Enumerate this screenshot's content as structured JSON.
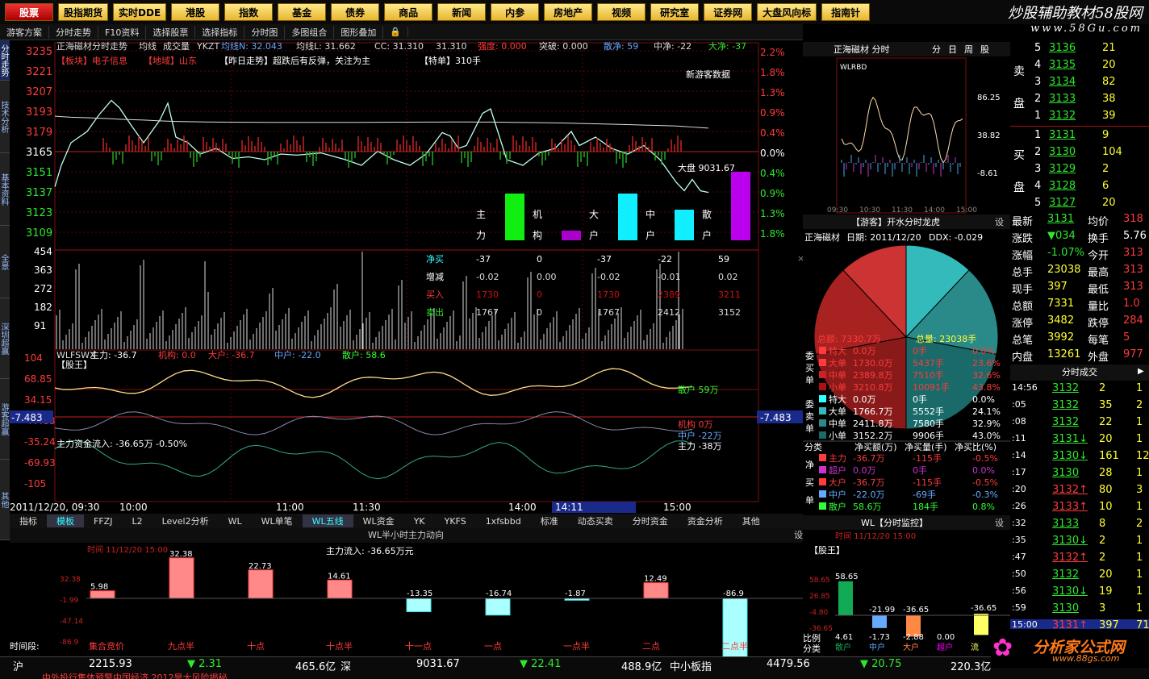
{
  "nav": [
    "股票",
    "股指期货",
    "实时DDE",
    "港股",
    "指数",
    "基金",
    "债券",
    "商品",
    "新闻",
    "内参",
    "房地产",
    "视频",
    "研究室",
    "证券网",
    "大盘风向标",
    "指南针"
  ],
  "brand": {
    "title": "炒股辅助教材58股网",
    "url": "www.58Gu.com"
  },
  "toolbar": [
    "游客方案",
    "分时走势",
    "F10资料",
    "选择股票",
    "选择指标",
    "分时图",
    "多图组合",
    "图形叠加"
  ],
  "chart_header": {
    "title": "正海磁材分时走势",
    "ind": "均线",
    "vol": "成交量",
    "yk": "YKZT",
    "jx_label": "均线N:",
    "jx": "32.043",
    "jxl_label": "均线L:",
    "jxl": "31.662",
    "cc": "CC: 31.310",
    "cc2": "31.310",
    "ysh": "强度:",
    "ysh_v": "0.000",
    "tp": "突破: 0.000",
    "sj": "散净: 59",
    "zj": "中净: -22",
    "dj": "大净: -37"
  },
  "tags": {
    "block": "【板块】电子信息",
    "area": "【地域】山东",
    "trend": "【昨日走势】超跌后有反弹，关注为主",
    "tedan": "【特单】310手",
    "guest": "新游客数据"
  },
  "price_axis": [
    "3235",
    "3221",
    "3207",
    "3193",
    "3179",
    "3165",
    "3151",
    "3137",
    "3123",
    "3109"
  ],
  "pct_axis_up": [
    "2.2%",
    "1.8%",
    "1.3%",
    "0.9%",
    "0.4%",
    "0.0%"
  ],
  "pct_axis_dn": [
    "0.4%",
    "0.9%",
    "1.3%",
    "1.8%"
  ],
  "dapan": "大盘 9031.67",
  "bars_labels": [
    {
      "t": "主",
      "b": "力"
    },
    {
      "t": "机",
      "b": "构"
    },
    {
      "t": "大",
      "b": "户"
    },
    {
      "t": "中",
      "b": "户"
    },
    {
      "t": "散",
      "b": "户"
    }
  ],
  "vol_axis": [
    "454",
    "363",
    "272",
    "182",
    "91"
  ],
  "flow_table": {
    "rows": [
      {
        "k": "净买",
        "v": [
          "-37",
          "0",
          "-37",
          "-22",
          "59"
        ]
      },
      {
        "k": "增减",
        "v": [
          "-0.02",
          "0.00",
          "-0.02",
          "-0.01",
          "0.02"
        ]
      },
      {
        "k": "买入",
        "v": [
          "1730",
          "0",
          "1730",
          "2389",
          "3211"
        ]
      },
      {
        "k": "卖出",
        "v": [
          "1767",
          "0",
          "1767",
          "2412",
          "3152"
        ]
      }
    ]
  },
  "wl_header": {
    "name": "WLFSWX",
    "zl": "主力: -36.7",
    "jg": "机构: 0.0",
    "dh": "大户: -36.7",
    "zh": "中户: -22.0",
    "sh": "散户: 58.6"
  },
  "gw": "【股王】",
  "wl_axis": [
    "104",
    "68.85",
    "34.15",
    "-7.483",
    "-35.24",
    "-69.93",
    "-105"
  ],
  "wl_labels": {
    "sh": "散户 59万",
    "jg": "机构 0万",
    "zh": "中户 -22万",
    "zl": "主力 -38万",
    "flow": "主力资金流入: -36.65万  -0.50%",
    "cur": "-7.483"
  },
  "time_axis": {
    "date": "2011/12/20, 09:30",
    "t1": "10:00",
    "t2": "11:00",
    "t3": "11:30",
    "t4": "14:00",
    "t5": "14:11",
    "t6": "15:00"
  },
  "mid_tabs": [
    "指标",
    "模板",
    "FFZJ",
    "L2",
    "Level2分析",
    "WL",
    "WL单笔",
    "WL五线",
    "WL资金",
    "YK",
    "YKFS",
    "1xfsbbd",
    "标准",
    "动态买卖",
    "分时资金",
    "资金分析",
    "其他"
  ],
  "halfhour": {
    "title": "WL半小时主力动向",
    "time": "时间  11/12/20 15:00",
    "flow": "主力流入: -36.65万元",
    "axis": [
      "32.38",
      "-1.99",
      "-47.14",
      "-86.9"
    ],
    "tl": "时间段:",
    "bars": [
      {
        "v": 5.98,
        "lab": "集合竞价",
        "vl": "5.98"
      },
      {
        "v": 32.38,
        "lab": "九点半",
        "vl": "32.38"
      },
      {
        "v": 22.73,
        "lab": "十点",
        "vl": "22.73"
      },
      {
        "v": 14.61,
        "lab": "十点半",
        "vl": "14.61"
      },
      {
        "v": -13.35,
        "lab": "十一点",
        "vl": "-13.35"
      },
      {
        "v": -16.74,
        "lab": "一点",
        "vl": "-16.74"
      },
      {
        "v": -1.87,
        "lab": "一点半",
        "vl": "-1.87"
      },
      {
        "v": 12.49,
        "lab": "二点",
        "vl": "12.49"
      },
      {
        "v": -86.9,
        "lab": "二点半",
        "vl": "-86.9"
      }
    ]
  },
  "mini": {
    "title": "正海磁材 分时",
    "tabs": [
      "分",
      "日",
      "周",
      "股"
    ],
    "name": "WLRBD",
    "axis": [
      "86.25",
      "38.82",
      "-8.61"
    ],
    "times": [
      "09:30",
      "10:30",
      "11:30",
      "14:00",
      "15:00"
    ]
  },
  "pie": {
    "title": "【游客】开水分时龙虎",
    "name": "正海磁材",
    "date": "日期: 2011/12/20",
    "ddx": "DDX: -0.029",
    "total_amt": "总额: 7330.7万",
    "total_vol": "总量: 23038手",
    "buy": [
      {
        "k": "特大",
        "a": "0.0万",
        "v": "0手",
        "p": "0.0%"
      },
      {
        "k": "大单",
        "a": "1730.0万",
        "v": "5437手",
        "p": "23.6%"
      },
      {
        "k": "中单",
        "a": "2389.8万",
        "v": "7510手",
        "p": "32.6%"
      },
      {
        "k": "小单",
        "a": "3210.8万",
        "v": "10091手",
        "p": "43.8%"
      }
    ],
    "sell": [
      {
        "k": "特大",
        "a": "0.0万",
        "v": "0手",
        "p": "0.0%"
      },
      {
        "k": "大单",
        "a": "1766.7万",
        "v": "5552手",
        "p": "24.1%"
      },
      {
        "k": "中单",
        "a": "2411.8万",
        "v": "7580手",
        "p": "32.9%"
      },
      {
        "k": "小单",
        "a": "3152.2万",
        "v": "9906手",
        "p": "43.0%"
      }
    ],
    "buy_side": "委买单",
    "sell_side": "委卖单"
  },
  "net": {
    "hdr": [
      "分类",
      "净买额(万)",
      "净买量(手)",
      "净买比(%)"
    ],
    "side": "净买单",
    "rows": [
      {
        "k": "主力",
        "a": "-36.7万",
        "v": "-115手",
        "p": "-0.5%"
      },
      {
        "k": "超户",
        "a": "0.0万",
        "v": "0手",
        "p": "0.0%"
      },
      {
        "k": "大户",
        "a": "-36.7万",
        "v": "-115手",
        "p": "-0.5%"
      },
      {
        "k": "中户",
        "a": "-22.0万",
        "v": "-69手",
        "p": "-0.3%"
      },
      {
        "k": "散户",
        "a": "58.6万",
        "v": "184手",
        "p": "0.8%"
      }
    ]
  },
  "monitor": {
    "title": "WL【分时监控】",
    "time": "时间  11/12/20 15:00",
    "gw": "【股王】",
    "axis": [
      "58.65",
      "26.85",
      "-4.80",
      "-36.65"
    ],
    "bars": [
      {
        "v": 58.65,
        "vl": "58.65",
        "lab": "散户",
        "b": "4.61"
      },
      {
        "v": -21.99,
        "vl": "-21.99",
        "lab": "中户",
        "b": "-1.73"
      },
      {
        "v": -36.65,
        "vl": "-36.65",
        "lab": "大户",
        "b": "-2.88"
      },
      {
        "v": 0,
        "vl": "",
        "lab": "超户",
        "b": "0.00"
      },
      {
        "v": -36.65,
        "vl": "-36.65",
        "lab": "流",
        "b": ""
      }
    ],
    "side1": "比例",
    "side2": "分类"
  },
  "orderbook": {
    "sell": [
      {
        "n": "5",
        "p": "3136",
        "v": "21"
      },
      {
        "n": "4",
        "p": "3135",
        "v": "20"
      },
      {
        "n": "3",
        "p": "3134",
        "v": "82"
      },
      {
        "n": "2",
        "p": "3133",
        "v": "38"
      },
      {
        "n": "1",
        "p": "3132",
        "v": "39"
      }
    ],
    "buy": [
      {
        "n": "1",
        "p": "3131",
        "v": "9"
      },
      {
        "n": "2",
        "p": "3130",
        "v": "104"
      },
      {
        "n": "3",
        "p": "3129",
        "v": "2"
      },
      {
        "n": "4",
        "p": "3128",
        "v": "6"
      },
      {
        "n": "5",
        "p": "3127",
        "v": "20"
      }
    ],
    "sl1": "卖",
    "sl2": "盘",
    "bl1": "买",
    "bl2": "盘"
  },
  "quote": [
    {
      "k": "最新",
      "v": "3131",
      "k2": "均价",
      "v2": "318"
    },
    {
      "k": "涨跌",
      "v": "▼034",
      "k2": "换手",
      "v2": "5.76"
    },
    {
      "k": "涨幅",
      "v": "-1.07%",
      "k2": "今开",
      "v2": "313"
    },
    {
      "k": "总手",
      "v": "23038",
      "k2": "最高",
      "v2": "313"
    },
    {
      "k": "现手",
      "v": "397",
      "k2": "最低",
      "v2": "313"
    },
    {
      "k": "总额",
      "v": "7331",
      "k2": "量比",
      "v2": "1.0"
    },
    {
      "k": "涨停",
      "v": "3482",
      "k2": "跌停",
      "v2": "284"
    },
    {
      "k": "总笔",
      "v": "3992",
      "k2": "每笔",
      "v2": "5"
    },
    {
      "k": "内盘",
      "v": "13261",
      "k2": "外盘",
      "v2": "977"
    }
  ],
  "ticks_title": "分时成交",
  "ticks": [
    {
      "t": "14:56",
      "p": "3132",
      "v": "2",
      "s": "1"
    },
    {
      "t": ":05",
      "p": "3132",
      "v": "35",
      "s": "2"
    },
    {
      "t": ":08",
      "p": "3132",
      "v": "22",
      "s": "1"
    },
    {
      "t": ":11",
      "p": "3131↓",
      "v": "20",
      "s": "1"
    },
    {
      "t": ":14",
      "p": "3130↓",
      "v": "161",
      "s": "12"
    },
    {
      "t": ":17",
      "p": "3130",
      "v": "28",
      "s": "1"
    },
    {
      "t": ":20",
      "p": "3132↑",
      "v": "80",
      "s": "3"
    },
    {
      "t": ":26",
      "p": "3133↑",
      "v": "10",
      "s": "1"
    },
    {
      "t": ":32",
      "p": "3133",
      "v": "8",
      "s": "2"
    },
    {
      "t": ":35",
      "p": "3130↓",
      "v": "2",
      "s": "1"
    },
    {
      "t": ":47",
      "p": "3132↑",
      "v": "2",
      "s": "1"
    },
    {
      "t": ":50",
      "p": "3132",
      "v": "20",
      "s": "1"
    },
    {
      "t": ":56",
      "p": "3130↓",
      "v": "19",
      "s": "1"
    },
    {
      "t": ":59",
      "p": "3130",
      "v": "3",
      "s": "1"
    },
    {
      "t": "15:00",
      "p": "3131↑",
      "v": "397",
      "s": "71"
    }
  ],
  "bottom": {
    "sh": "沪",
    "sh_v": "2215.93",
    "sh_c": "▼ 2.31",
    "sh_a": "465.6亿",
    "sz": "深",
    "sz_v": "9031.67",
    "sz_c": "▼ 22.41",
    "sz_a": "488.9亿",
    "zx": "中小板指",
    "zx_v": "4479.56",
    "zx_c": "▼ 20.75",
    "zx_a": "220.3亿",
    "news": "中外投行集体预警中国经济 2012是大风险揭秘"
  },
  "logo": {
    "t": "分析家公式网",
    "u": "www.88gs.com"
  },
  "vtabs": [
    "分时走势",
    "技术分析",
    "基本资料",
    "全景",
    "深圳超赢",
    "游客超赢",
    "其他"
  ]
}
